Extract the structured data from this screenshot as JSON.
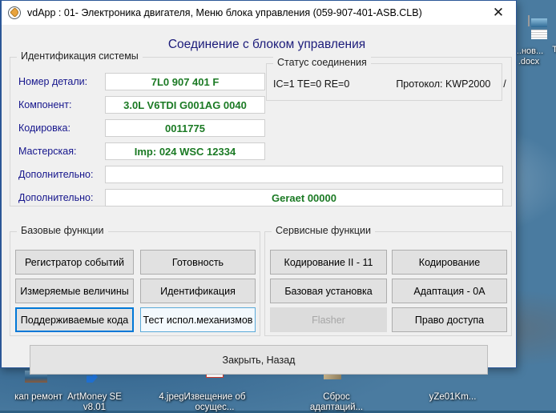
{
  "window": {
    "title": "vdApp : 01- Электроника двигателя,  Меню блока управления (059-907-401-ASB.CLB)",
    "close_label": "✕",
    "icon": "app-tag-icon"
  },
  "heading": "Соединение с блоком управления",
  "identification": {
    "group_title": "Идентификация системы",
    "rows": [
      {
        "label": "Номер детали:",
        "value": "7L0 907 401 F"
      },
      {
        "label": "Компонент:",
        "value": "3.0L V6TDI  G001AG  0040"
      },
      {
        "label": "Кодировка:",
        "value": "0011775"
      },
      {
        "label": "Мастерская:",
        "value": "Imp: 024    WSC 12334"
      },
      {
        "label": "Дополнительно:",
        "value": ""
      },
      {
        "label": "Дополнительно:",
        "value": "Geraet 00000"
      }
    ]
  },
  "status": {
    "group_title": "Статус соединения",
    "ic_te_re": "IC=1  TE=0  RE=0",
    "protocol_label": "Протокол: KWP2000",
    "spinner": "/"
  },
  "base_functions": {
    "group_title": "Базовые функции",
    "buttons": [
      {
        "label": "Регистратор событий",
        "state": "normal"
      },
      {
        "label": "Готовность",
        "state": "normal"
      },
      {
        "label": "Измеряемые величины",
        "state": "normal"
      },
      {
        "label": "Идентификация",
        "state": "normal"
      },
      {
        "label": "Поддерживаемые кода",
        "state": "focused"
      },
      {
        "label": "Тест испол.механизмов",
        "state": "hovered"
      }
    ]
  },
  "service_functions": {
    "group_title": "Сервисные функции",
    "buttons": [
      {
        "label": "Кодирование II - 11",
        "state": "normal"
      },
      {
        "label": "Кодирование",
        "state": "normal"
      },
      {
        "label": "Базовая установка",
        "state": "normal"
      },
      {
        "label": "Адаптация - 0A",
        "state": "normal"
      },
      {
        "label": "Flasher",
        "state": "disabled"
      },
      {
        "label": "Право доступа",
        "state": "normal"
      }
    ]
  },
  "close_back_button": "Закрыть, Назад",
  "desktop": {
    "icons": [
      {
        "label": "кап ремонт",
        "icon": "photo-icon"
      },
      {
        "label": "ArtMoney SE\nv8.01",
        "icon": "shortcut-icon"
      },
      {
        "label": "4.jpeg",
        "icon": "blank-image-icon"
      },
      {
        "label": "Извещение\nоб осущес...",
        "icon": "pdf-icon"
      },
      {
        "label": "Сброс\nадаптаций...",
        "icon": "document-image-icon"
      },
      {
        "label": "yZe01Km...",
        "icon": "window-icon"
      },
      {
        "label": "...нов...\n.docx",
        "icon": "docx-page-icon"
      },
      {
        "label": "Та...",
        "icon": "word-icon"
      }
    ]
  },
  "colors": {
    "accent_focus": "#0078D7",
    "field_value": "#1B7A24",
    "heading": "#1B1B7A",
    "label": "#15158C",
    "window_border": "#2B5797"
  }
}
